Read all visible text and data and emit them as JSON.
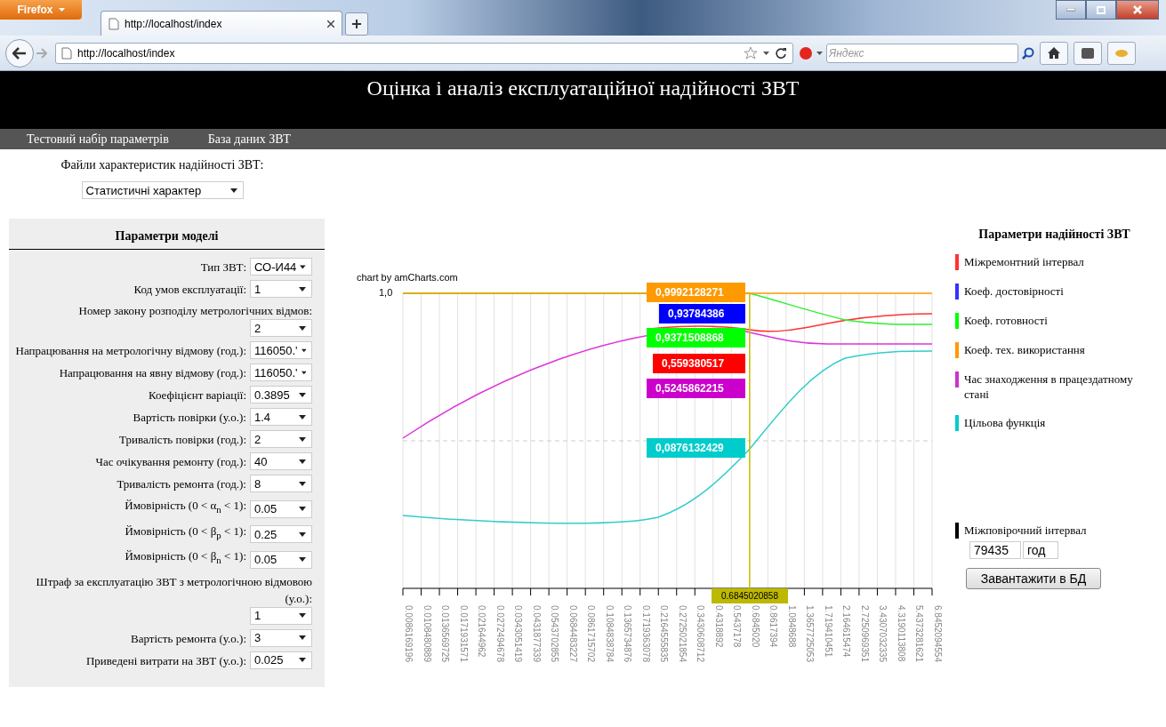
{
  "browser": {
    "menu_button": "Firefox",
    "tab": {
      "title": "http://localhost/index"
    },
    "address": "http://localhost/index",
    "search": {
      "placeholder": "Яндекс"
    }
  },
  "header": {
    "title": "Оцінка і аналіз експлуатаційної надійності ЗВТ"
  },
  "nav": [
    {
      "label": "Тестовий набір параметрів"
    },
    {
      "label": "База даних ЗВТ"
    }
  ],
  "files": {
    "label": "Файли характеристик надійності ЗВТ:",
    "value": "Статистичні характер"
  },
  "model": {
    "title": "Параметри моделі",
    "fields": [
      {
        "label": "Тип ЗВТ:",
        "value": "СО-И44"
      },
      {
        "label": "Код умов експлуатації:",
        "value": "1"
      },
      {
        "label": "Номер закону розподілу метрологічних відмов:",
        "value": "2"
      },
      {
        "label": "Напрацювання на метрологічну відмову (год.):",
        "value": "116050.'"
      },
      {
        "label": "Напрацювання на явну відмову (год.):",
        "value": "116050.'"
      },
      {
        "label": "Коефіцієнт варіації:",
        "value": "0.3895"
      },
      {
        "label": "Вартість повірки (у.о.):",
        "value": "1.4"
      },
      {
        "label": "Тривалість повірки (год.):",
        "value": "2"
      },
      {
        "label": "Час очікування ремонту (год.):",
        "value": "40"
      },
      {
        "label": "Тривалість ремонта (год.):",
        "value": "8"
      },
      {
        "label": "Ймовірність (0 < α$_{n}$ < 1):",
        "value": "0.05"
      },
      {
        "label": "Ймовірність (0 < β$_{p}$ < 1):",
        "value": "0.25"
      },
      {
        "label": "Ймовірність (0 < β$_{n}$ < 1):",
        "value": "0.05"
      },
      {
        "label": "Штраф за експлуатацію ЗВТ з метрологічною відмовою (у.о.):",
        "value": "1"
      },
      {
        "label": "Вартість ремонта (у.о.):",
        "value": "3"
      },
      {
        "label": "Приведені витрати на ЗВТ (у.о.):",
        "value": "0.025"
      }
    ]
  },
  "chart": {
    "credit": "chart by amCharts.com",
    "y_label": "1,0",
    "cursor_label": "0.6845020858",
    "balloons": [
      {
        "value": "0,9992128271",
        "color": "#ff9900"
      },
      {
        "value": "0,93784386",
        "color": "#0000ff"
      },
      {
        "value": "0,9371508868",
        "color": "#00ff00"
      },
      {
        "value": "0,559380517",
        "color": "#ff0000"
      },
      {
        "value": "0,5245862215",
        "color": "#cc00cc"
      },
      {
        "value": "0,0876132429",
        "color": "#00cccc"
      }
    ],
    "x_labels": [
      "0.0086169196",
      "0.0108480889",
      "0.0136569725",
      "0.0171931571",
      "0.021644962",
      "0.0272494678",
      "0.0343051419",
      "0.0431877339",
      "0.0543702855",
      "0.0684483227",
      "0.0861715702",
      "0.1084838784",
      "0.1365734876",
      "0.1719363078",
      "0.2164555835",
      "0.2725021854",
      "0.3430608712",
      "0.4318892",
      "0.5437178",
      "0.6845020",
      "0.8617394",
      "1.0848688",
      "1.3657725053",
      "1.719410451",
      "2.164615474",
      "2.7250969351",
      "3.4307032335",
      "4.3190113808",
      "5.4373281621",
      "6.8452094554"
    ]
  },
  "reliability": {
    "title": "Параметри надійності ЗВТ",
    "items": [
      {
        "label": "Міжремонтний інтервал",
        "color": "#ff3333"
      },
      {
        "label": "Коеф. достовірності",
        "color": "#3333ff"
      },
      {
        "label": "Коеф. готовності",
        "color": "#00ff00"
      },
      {
        "label": "Коеф. тех. використання",
        "color": "#ff9900"
      },
      {
        "label": "Час знаходження в працездатному стані",
        "color": "#cc33cc"
      },
      {
        "label": "Цільова функція",
        "color": "#00cccc"
      }
    ],
    "interval": {
      "label": "Міжповірочний інтервал",
      "value": "79435",
      "unit": "год"
    },
    "button": "Завантажити в БД"
  }
}
